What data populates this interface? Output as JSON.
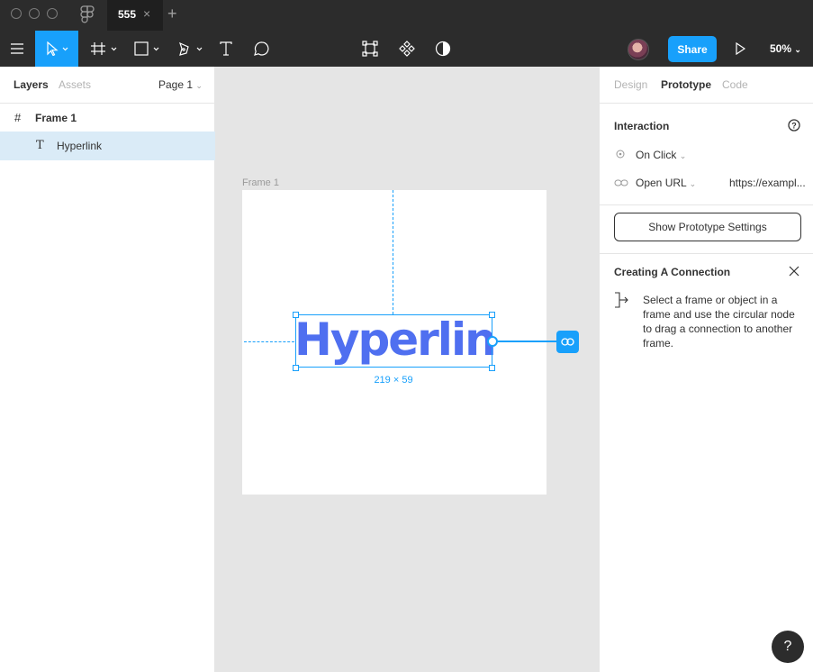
{
  "tab": {
    "title": "555"
  },
  "toolbar": {
    "share_label": "Share",
    "zoom_label": "50%"
  },
  "layers_panel": {
    "tabs": [
      "Layers",
      "Assets"
    ],
    "page_label": "Page 1",
    "layers": [
      {
        "label": "Frame 1",
        "type": "frame"
      },
      {
        "label": "Hyperlink",
        "type": "text",
        "selected": true
      }
    ]
  },
  "canvas": {
    "frame_label": "Frame 1",
    "text_content": "Hyperlink",
    "dimension_label": "219 × 59",
    "text_color": "#4f6ff0"
  },
  "inspector": {
    "tabs": [
      "Design",
      "Prototype",
      "Code"
    ],
    "active_tab": "Prototype",
    "interaction_heading": "Interaction",
    "trigger_label": "On Click",
    "action_label": "Open URL",
    "url_value": "https://exampl...",
    "prototype_settings_label": "Show Prototype Settings",
    "connection_heading": "Creating A Connection",
    "connection_text": "Select a frame or object in a frame and use the circular node to drag a connection to another frame."
  },
  "help_label": "?",
  "colors": {
    "accent": "#18a0fb",
    "toolbar_bg": "#2c2c2c",
    "selected_layer_bg": "#daebf7"
  }
}
